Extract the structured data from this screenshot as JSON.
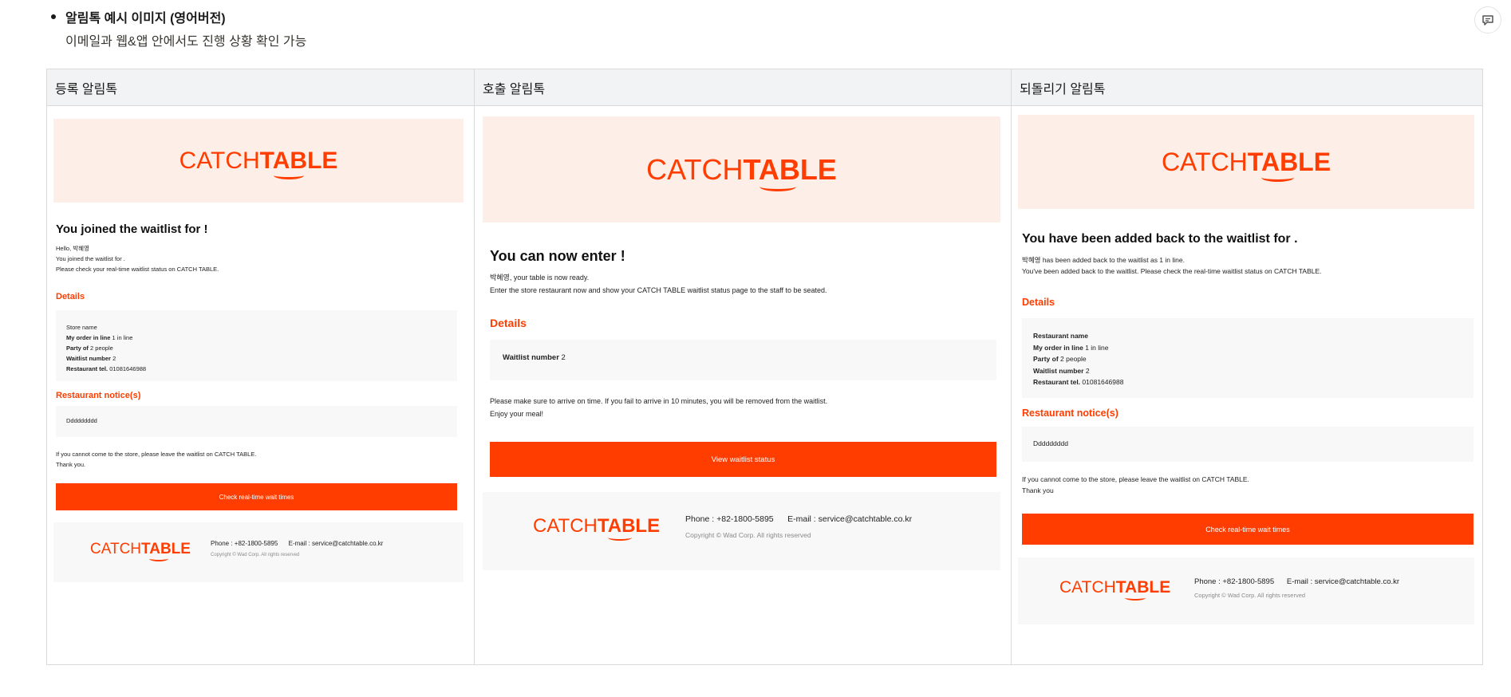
{
  "bullet": {
    "title": "알림톡 예시 이미지 (영어버전)",
    "subtitle": "이메일과 웹&앱 안에서도 진행 상황 확인 가능"
  },
  "icons": {
    "comment": "comment-icon"
  },
  "brand": {
    "accent": "#ff3d00",
    "hero_bg": "#fdeee7"
  },
  "columns": [
    {
      "header": "등록 알림톡",
      "logo_thin": "CATCH",
      "logo_bold": "TABLE",
      "heading": "You joined the waitlist for !",
      "intro": [
        "Hello, 박혜영",
        "You joined the waitlist for .",
        "Please check your real-time waitlist status on CATCH TABLE."
      ],
      "details_title": "Details",
      "details": [
        {
          "label": "Store name",
          "value": ""
        },
        {
          "label": "My order in line",
          "value": "1 in line"
        },
        {
          "label": "Party of",
          "value": "2 people"
        },
        {
          "label": "Waitlist number",
          "value": "2"
        },
        {
          "label": "Restaurant tel.",
          "value": "01081646988"
        }
      ],
      "notice_title": "Restaurant notice(s)",
      "notice": "Ddddddddd",
      "outro": [
        "If you cannot come to the store, please leave the waitlist on CATCH TABLE.",
        "Thank you."
      ],
      "button": "Check real-time wait times",
      "footer_contact": "Phone : +82-1800-5895      E-mail : service@catchtable.co.kr",
      "footer_copy": "Copyright © Wad Corp. All rights reserved"
    },
    {
      "header": "호출 알림톡",
      "logo_thin": "CATCH",
      "logo_bold": "TABLE",
      "heading": "You can now enter !",
      "intro": [
        "박혜영, your table is now ready.",
        "Enter the store restaurant now and show your CATCH TABLE waitlist status page to the staff to be seated."
      ],
      "details_title": "Details",
      "details": [
        {
          "label": "Waitlist number",
          "value": "2"
        }
      ],
      "outro": [
        "Please make sure to arrive on time. If you fail to arrive in 10 minutes, you will be removed from the waitlist.",
        "Enjoy your meal!"
      ],
      "button": "View waitlist status",
      "footer_contact": "Phone : +82-1800-5895      E-mail : service@catchtable.co.kr",
      "footer_copy": "Copyright © Wad Corp. All rights reserved"
    },
    {
      "header": "되돌리기 알림톡",
      "logo_thin": "CATCH",
      "logo_bold": "TABLE",
      "heading": "You have been added back to the waitlist for .",
      "intro": [
        "박혜영 has been added back to the waitlist as 1 in line.",
        "You've been added back to the waitlist. Please check the real-time waitlist status on CATCH TABLE."
      ],
      "details_title": "Details",
      "details": [
        {
          "label": "Restaurant name",
          "value": ""
        },
        {
          "label": "My order in line",
          "value": "1 in line"
        },
        {
          "label": "Party of",
          "value": "2 people"
        },
        {
          "label": "Waitlist number",
          "value": "2"
        },
        {
          "label": "Restaurant tel.",
          "value": "01081646988"
        }
      ],
      "notice_title": "Restaurant notice(s)",
      "notice": "Ddddddddd",
      "outro": [
        "If you cannot come to the store, please leave the waitlist on CATCH TABLE.",
        "Thank you"
      ],
      "button": "Check real-time wait times",
      "footer_contact": "Phone : +82-1800-5895      E-mail : service@catchtable.co.kr",
      "footer_copy": "Copyright © Wad Corp. All rights reserved"
    }
  ]
}
